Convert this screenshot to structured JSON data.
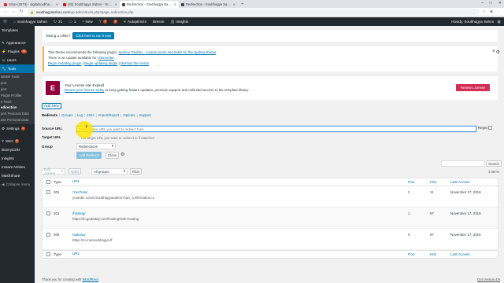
{
  "browser": {
    "tabs": [
      {
        "label": "Inbox (2574) - digitalsoubhagy...",
        "favicon_color": "#d93025",
        "active": false
      },
      {
        "label": "(20) Soubhagya Sahoo - YouTube",
        "favicon_color": "#ff0000",
        "active": false
      },
      {
        "label": "Redirection ‹ Soubhagya Sahoo",
        "favicon_color": "#464646",
        "active": true
      },
      {
        "label": "Redirection ‹ Soubhagya Sahoo...",
        "favicon_color": "#464646",
        "active": false
      }
    ],
    "new_tab": "+",
    "url_domain": "soubhagyasahoo.com",
    "url_path": "/wp-admin/tools.php?page=redirection.php"
  },
  "adminbar": {
    "site_name": "Soubhagya Sahoo",
    "updates_count": "21",
    "comments_count": "1",
    "new_label": "+ New",
    "badge_a": "2",
    "badge_b": "2",
    "autoptimize": "Autoptimize",
    "breeze": "Breeze",
    "insights": "Insights",
    "howdy": "Howdy, Soubhagya Sahoo"
  },
  "sidebar": {
    "items_top": [
      {
        "label": "Templates"
      },
      {
        "label": "Appearance"
      },
      {
        "label": "Plugins",
        "badge": "19"
      },
      {
        "label": "Users"
      },
      {
        "label": "Tools",
        "current": true
      }
    ],
    "sub_items": [
      {
        "label": "ailable Tools"
      },
      {
        "label": "port"
      },
      {
        "label": "port"
      },
      {
        "label": "Plugin Profiler"
      },
      {
        "label": "e Tests"
      },
      {
        "label": "edirection",
        "current": true
      },
      {
        "label": "port Personal Data"
      },
      {
        "label": "ase Personal Data"
      }
    ],
    "items_bottom": [
      {
        "label": "Settings",
        "badge": "1"
      },
      {
        "label": "SEO",
        "badge": "4"
      },
      {
        "label": "BunnyCDN"
      },
      {
        "label": "Insights"
      },
      {
        "label": "Instant Articles"
      },
      {
        "label": "MashShare"
      },
      {
        "label": "Collapse menu"
      }
    ]
  },
  "notice_grey": {
    "text": "Taking a while?",
    "button": "Click here to run it now"
  },
  "notice_theme": {
    "line1_prefix": "This theme recommends the following plugin: ",
    "line1_link": "Sydney Toolbox - custom posts and fields for the Sydney theme",
    "line1_suffix": ".",
    "line2_prefix": "There is an update available for: ",
    "line2_link": "Elementor",
    "line2_suffix": ".",
    "link_install": "Begin installing plugin",
    "link_update": "Begin updating plugin",
    "link_dismiss": "Dismiss this notice",
    "divider": "|"
  },
  "notice_license": {
    "title": "Your License Has Expired",
    "link": "Renew your license today",
    "rest": " to keep getting feature updates, premium support and unlimited access to the template library.",
    "button": "Renew License"
  },
  "add_new": "Add New",
  "subnav": {
    "items": [
      "Redirects",
      "Groups",
      "Log",
      "404s",
      "Import/Export",
      "Options",
      "Support"
    ],
    "sep": "|"
  },
  "form": {
    "source_label": "Source URL",
    "source_placeholder": "The relative URL you want to redirect from",
    "regex_label": "Regex",
    "target_label": "Target URL",
    "target_placeholder": "The target URL you want to redirect to if matched",
    "group_label": "Group",
    "group_value": "Redirections",
    "add_button": "Add Redirect",
    "close_button": "Close"
  },
  "search_button": "Search",
  "bulk": {
    "bulk_actions": "Bulk Actions",
    "apply": "Apply",
    "groups": "All groups",
    "filter": "Filter",
    "count": "3 items"
  },
  "table": {
    "headers": {
      "type": "Type",
      "url": "URL",
      "pos": "Pos",
      "hits": "Hits",
      "last": "Last Access"
    },
    "rows": [
      {
        "type": "301",
        "source": "/YouTube/",
        "target": "youtube.com/c/soubhagyasahoo?sub_confirmation=1",
        "pos": "2",
        "hits": "11",
        "last": "November 17, 2018"
      },
      {
        "type": "301",
        "source": "/hosting/",
        "target": "https://in.godaddy.com/hosting/web-hosting",
        "pos": "1",
        "hits": "97",
        "last": "November 17, 2018"
      },
      {
        "type": "308",
        "source": "/aakasu/",
        "target": "https://m.me/soubhagya.ff",
        "pos": "0",
        "hits": "97",
        "last": "November 17, 2018"
      }
    ]
  },
  "footer": {
    "prefix": "Thank you for creating with ",
    "link": "WordPress",
    "version": "Get Version 4.9"
  }
}
